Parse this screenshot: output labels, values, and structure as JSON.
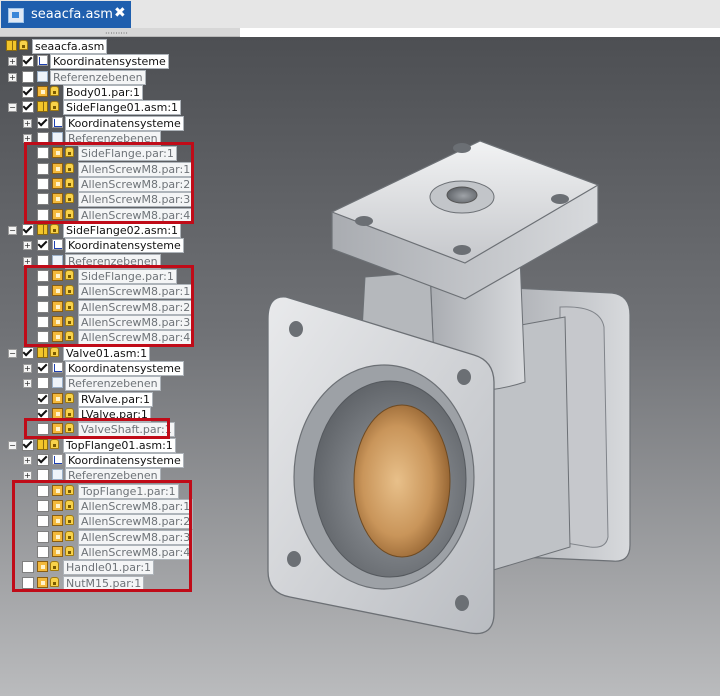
{
  "window": {
    "tab_title": "seaacfa.asm",
    "close_glyph": "✖",
    "splitter_grip": "·········"
  },
  "tree": [
    {
      "label": "seaacfa.asm",
      "depth": 0,
      "expand": "",
      "checked": null,
      "icon": "asm",
      "lock": true,
      "dim": false
    },
    {
      "label": "Koordinatensysteme",
      "depth": 0,
      "expand": "+",
      "checked": true,
      "icon": "coord",
      "lock": false,
      "dim": false
    },
    {
      "label": "Referenzebenen",
      "depth": 0,
      "expand": "+",
      "checked": false,
      "icon": "plane",
      "lock": false,
      "dim": true
    },
    {
      "label": "Body01.par:1",
      "depth": 0,
      "expand": "",
      "checked": true,
      "icon": "par",
      "lock": true,
      "dim": false
    },
    {
      "label": "SideFlange01.asm:1",
      "depth": 0,
      "expand": "−",
      "checked": true,
      "icon": "asm",
      "lock": true,
      "dim": false
    },
    {
      "label": "Koordinatensysteme",
      "depth": 1,
      "expand": "+",
      "checked": true,
      "icon": "coord",
      "lock": false,
      "dim": false
    },
    {
      "label": "Referenzebenen",
      "depth": 1,
      "expand": "+",
      "checked": false,
      "icon": "plane",
      "lock": false,
      "dim": true
    },
    {
      "label": "SideFlange.par:1",
      "depth": 1,
      "expand": "",
      "checked": false,
      "icon": "par",
      "lock": true,
      "dim": true
    },
    {
      "label": "AllenScrewM8.par:1",
      "depth": 1,
      "expand": "",
      "checked": false,
      "icon": "par",
      "lock": true,
      "dim": true
    },
    {
      "label": "AllenScrewM8.par:2",
      "depth": 1,
      "expand": "",
      "checked": false,
      "icon": "par",
      "lock": true,
      "dim": true
    },
    {
      "label": "AllenScrewM8.par:3",
      "depth": 1,
      "expand": "",
      "checked": false,
      "icon": "par",
      "lock": true,
      "dim": true
    },
    {
      "label": "AllenScrewM8.par:4",
      "depth": 1,
      "expand": "",
      "checked": false,
      "icon": "par",
      "lock": true,
      "dim": true
    },
    {
      "label": "SideFlange02.asm:1",
      "depth": 0,
      "expand": "−",
      "checked": true,
      "icon": "asm",
      "lock": true,
      "dim": false
    },
    {
      "label": "Koordinatensysteme",
      "depth": 1,
      "expand": "+",
      "checked": true,
      "icon": "coord",
      "lock": false,
      "dim": false
    },
    {
      "label": "Referenzebenen",
      "depth": 1,
      "expand": "+",
      "checked": false,
      "icon": "plane",
      "lock": false,
      "dim": true
    },
    {
      "label": "SideFlange.par:1",
      "depth": 1,
      "expand": "",
      "checked": false,
      "icon": "par",
      "lock": true,
      "dim": true
    },
    {
      "label": "AllenScrewM8.par:1",
      "depth": 1,
      "expand": "",
      "checked": false,
      "icon": "par",
      "lock": true,
      "dim": true
    },
    {
      "label": "AllenScrewM8.par:2",
      "depth": 1,
      "expand": "",
      "checked": false,
      "icon": "par",
      "lock": true,
      "dim": true
    },
    {
      "label": "AllenScrewM8.par:3",
      "depth": 1,
      "expand": "",
      "checked": false,
      "icon": "par",
      "lock": true,
      "dim": true
    },
    {
      "label": "AllenScrewM8.par:4",
      "depth": 1,
      "expand": "",
      "checked": false,
      "icon": "par",
      "lock": true,
      "dim": true
    },
    {
      "label": "Valve01.asm:1",
      "depth": 0,
      "expand": "−",
      "checked": true,
      "icon": "asm",
      "lock": true,
      "dim": false
    },
    {
      "label": "Koordinatensysteme",
      "depth": 1,
      "expand": "+",
      "checked": true,
      "icon": "coord",
      "lock": false,
      "dim": false
    },
    {
      "label": "Referenzebenen",
      "depth": 1,
      "expand": "+",
      "checked": false,
      "icon": "plane",
      "lock": false,
      "dim": true
    },
    {
      "label": "RValve.par:1",
      "depth": 1,
      "expand": "",
      "checked": true,
      "icon": "par",
      "lock": true,
      "dim": false
    },
    {
      "label": "LValve.par:1",
      "depth": 1,
      "expand": "",
      "checked": true,
      "icon": "par",
      "lock": true,
      "dim": false
    },
    {
      "label": "ValveShaft.par:1",
      "depth": 1,
      "expand": "",
      "checked": false,
      "icon": "par",
      "lock": true,
      "dim": true
    },
    {
      "label": "TopFlange01.asm:1",
      "depth": 0,
      "expand": "−",
      "checked": true,
      "icon": "asm",
      "lock": true,
      "dim": false
    },
    {
      "label": "Koordinatensysteme",
      "depth": 1,
      "expand": "+",
      "checked": true,
      "icon": "coord",
      "lock": false,
      "dim": false
    },
    {
      "label": "Referenzebenen",
      "depth": 1,
      "expand": "+",
      "checked": false,
      "icon": "plane",
      "lock": false,
      "dim": true
    },
    {
      "label": "TopFlange1.par:1",
      "depth": 1,
      "expand": "",
      "checked": false,
      "icon": "par",
      "lock": true,
      "dim": true
    },
    {
      "label": "AllenScrewM8.par:1",
      "depth": 1,
      "expand": "",
      "checked": false,
      "icon": "par",
      "lock": true,
      "dim": true
    },
    {
      "label": "AllenScrewM8.par:2",
      "depth": 1,
      "expand": "",
      "checked": false,
      "icon": "par",
      "lock": true,
      "dim": true
    },
    {
      "label": "AllenScrewM8.par:3",
      "depth": 1,
      "expand": "",
      "checked": false,
      "icon": "par",
      "lock": true,
      "dim": true
    },
    {
      "label": "AllenScrewM8.par:4",
      "depth": 1,
      "expand": "",
      "checked": false,
      "icon": "par",
      "lock": true,
      "dim": true
    },
    {
      "label": "Handle01.par:1",
      "depth": 0,
      "expand": "",
      "checked": false,
      "icon": "par",
      "lock": true,
      "dim": true
    },
    {
      "label": "NutM15.par:1",
      "depth": 0,
      "expand": "",
      "checked": false,
      "icon": "par",
      "lock": true,
      "dim": true
    }
  ],
  "highlight_groups": [
    {
      "first": 7,
      "last": 11
    },
    {
      "first": 15,
      "last": 19
    },
    {
      "first": 25,
      "last": 25
    },
    {
      "first": 29,
      "last": 35
    }
  ],
  "colors": {
    "tab": "#1f5fae",
    "highlight": "#c00b18",
    "body_metal": "#d4d6da",
    "valve_bronze": "#c9955a"
  }
}
